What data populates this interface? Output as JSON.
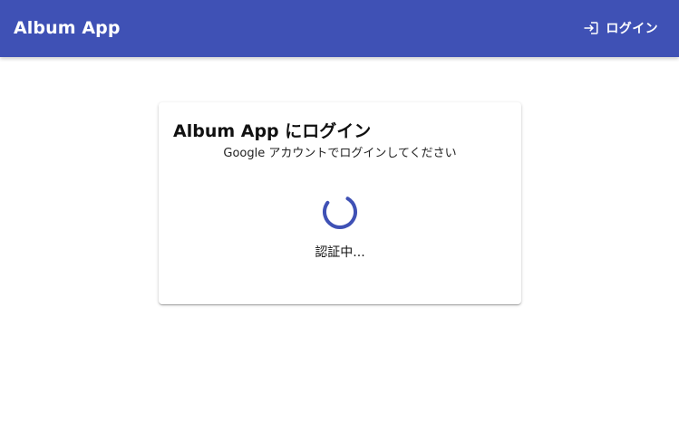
{
  "appbar": {
    "title": "Album App",
    "login_label": "ログイン",
    "login_icon": "login-icon",
    "background_color": "#3f51b5"
  },
  "login_card": {
    "title": "Album App にログイン",
    "subtitle": "Google アカウントでログインしてください",
    "spinner_icon": "loading-spinner-icon",
    "status": "認証中..."
  },
  "colors": {
    "primary": "#3f51b5"
  }
}
